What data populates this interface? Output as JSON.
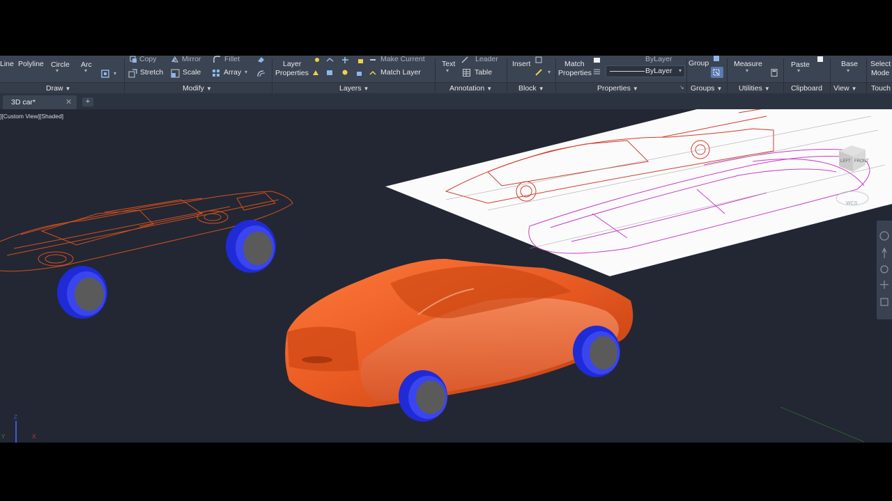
{
  "ribbon": {
    "draw": {
      "line": "Line",
      "polyline": "Polyline",
      "circle": "Circle",
      "arc": "Arc",
      "panel": "Draw"
    },
    "modify": {
      "copy": "Copy",
      "mirror": "Mirror",
      "fillet": "Fillet",
      "stretch": "Stretch",
      "scale": "Scale",
      "array": "Array",
      "panel": "Modify"
    },
    "layers": {
      "layer_properties_1": "Layer",
      "layer_properties_2": "Properties",
      "make_current": "Make Current",
      "match_layer": "Match Layer",
      "panel": "Layers"
    },
    "annotation": {
      "text": "Text",
      "leader": "Leader",
      "table": "Table",
      "panel": "Annotation"
    },
    "block": {
      "insert": "Insert",
      "panel": "Block"
    },
    "properties": {
      "match_1": "Match",
      "match_2": "Properties",
      "bylayer_1": "ByLayer",
      "bylayer_2": "ByLayer",
      "panel": "Properties"
    },
    "groups": {
      "group": "Group",
      "panel": "Groups"
    },
    "utilities": {
      "measure": "Measure",
      "panel": "Utilities"
    },
    "clipboard": {
      "paste": "Paste",
      "panel": "Clipboard"
    },
    "view": {
      "base": "Base",
      "panel": "View"
    },
    "touch": {
      "select_1": "Select",
      "select_2": "Mode",
      "panel": "Touch"
    }
  },
  "tabs": {
    "active": "3D car*",
    "close": "✕",
    "add": "+"
  },
  "viewport": {
    "label": "][Custom View][Shaded]",
    "viewcube": {
      "left": "LEFT",
      "front": "FRONT",
      "wcs": "WCS"
    },
    "axis": {
      "z": "Z",
      "y": "Y",
      "x": "X"
    },
    "colors": {
      "background": "#222733",
      "car_body": "#e0531b",
      "tire": "#1f2bd6",
      "wireframe": "#d4501e",
      "blueprint_magenta": "#c83cc8"
    }
  }
}
